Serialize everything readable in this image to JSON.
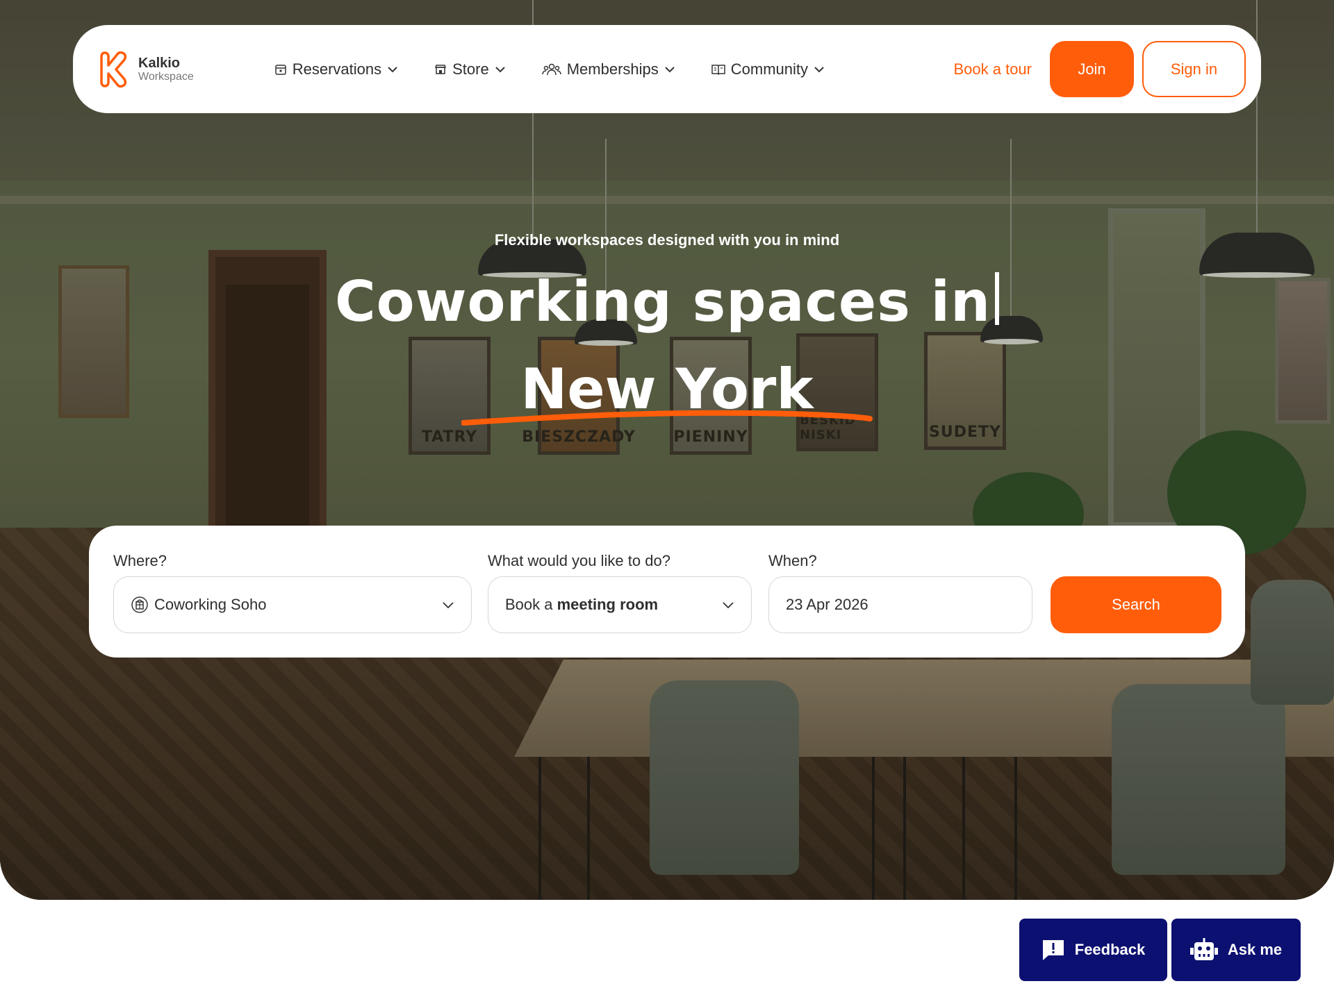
{
  "brand": {
    "name": "Kalkio",
    "subtitle": "Workspace",
    "accent": "#ff5d0a"
  },
  "nav": {
    "items": [
      {
        "label": "Reservations",
        "icon": "calendar-icon"
      },
      {
        "label": "Store",
        "icon": "store-icon"
      },
      {
        "label": "Memberships",
        "icon": "users-icon"
      },
      {
        "label": "Community",
        "icon": "book-icon"
      }
    ],
    "book_tour": "Book a tour",
    "join": "Join",
    "sign_in": "Sign in"
  },
  "hero": {
    "tagline": "Flexible workspaces designed with you in mind",
    "headline": "Coworking spaces in",
    "city": "New York",
    "posters": [
      "TATRY",
      "BIESZCZADY",
      "PIENINY",
      "BESKID NISKI",
      "SUDETY"
    ]
  },
  "search": {
    "where_label": "Where?",
    "where_value": "Coworking Soho",
    "what_label": "What would you like to do?",
    "what_prefix": "Book a",
    "what_bold": "meeting room",
    "when_label": "When?",
    "when_value": "23 Apr 2026",
    "button": "Search"
  },
  "floating": {
    "feedback": "Feedback",
    "ask": "Ask me",
    "color": "#0c1070"
  }
}
